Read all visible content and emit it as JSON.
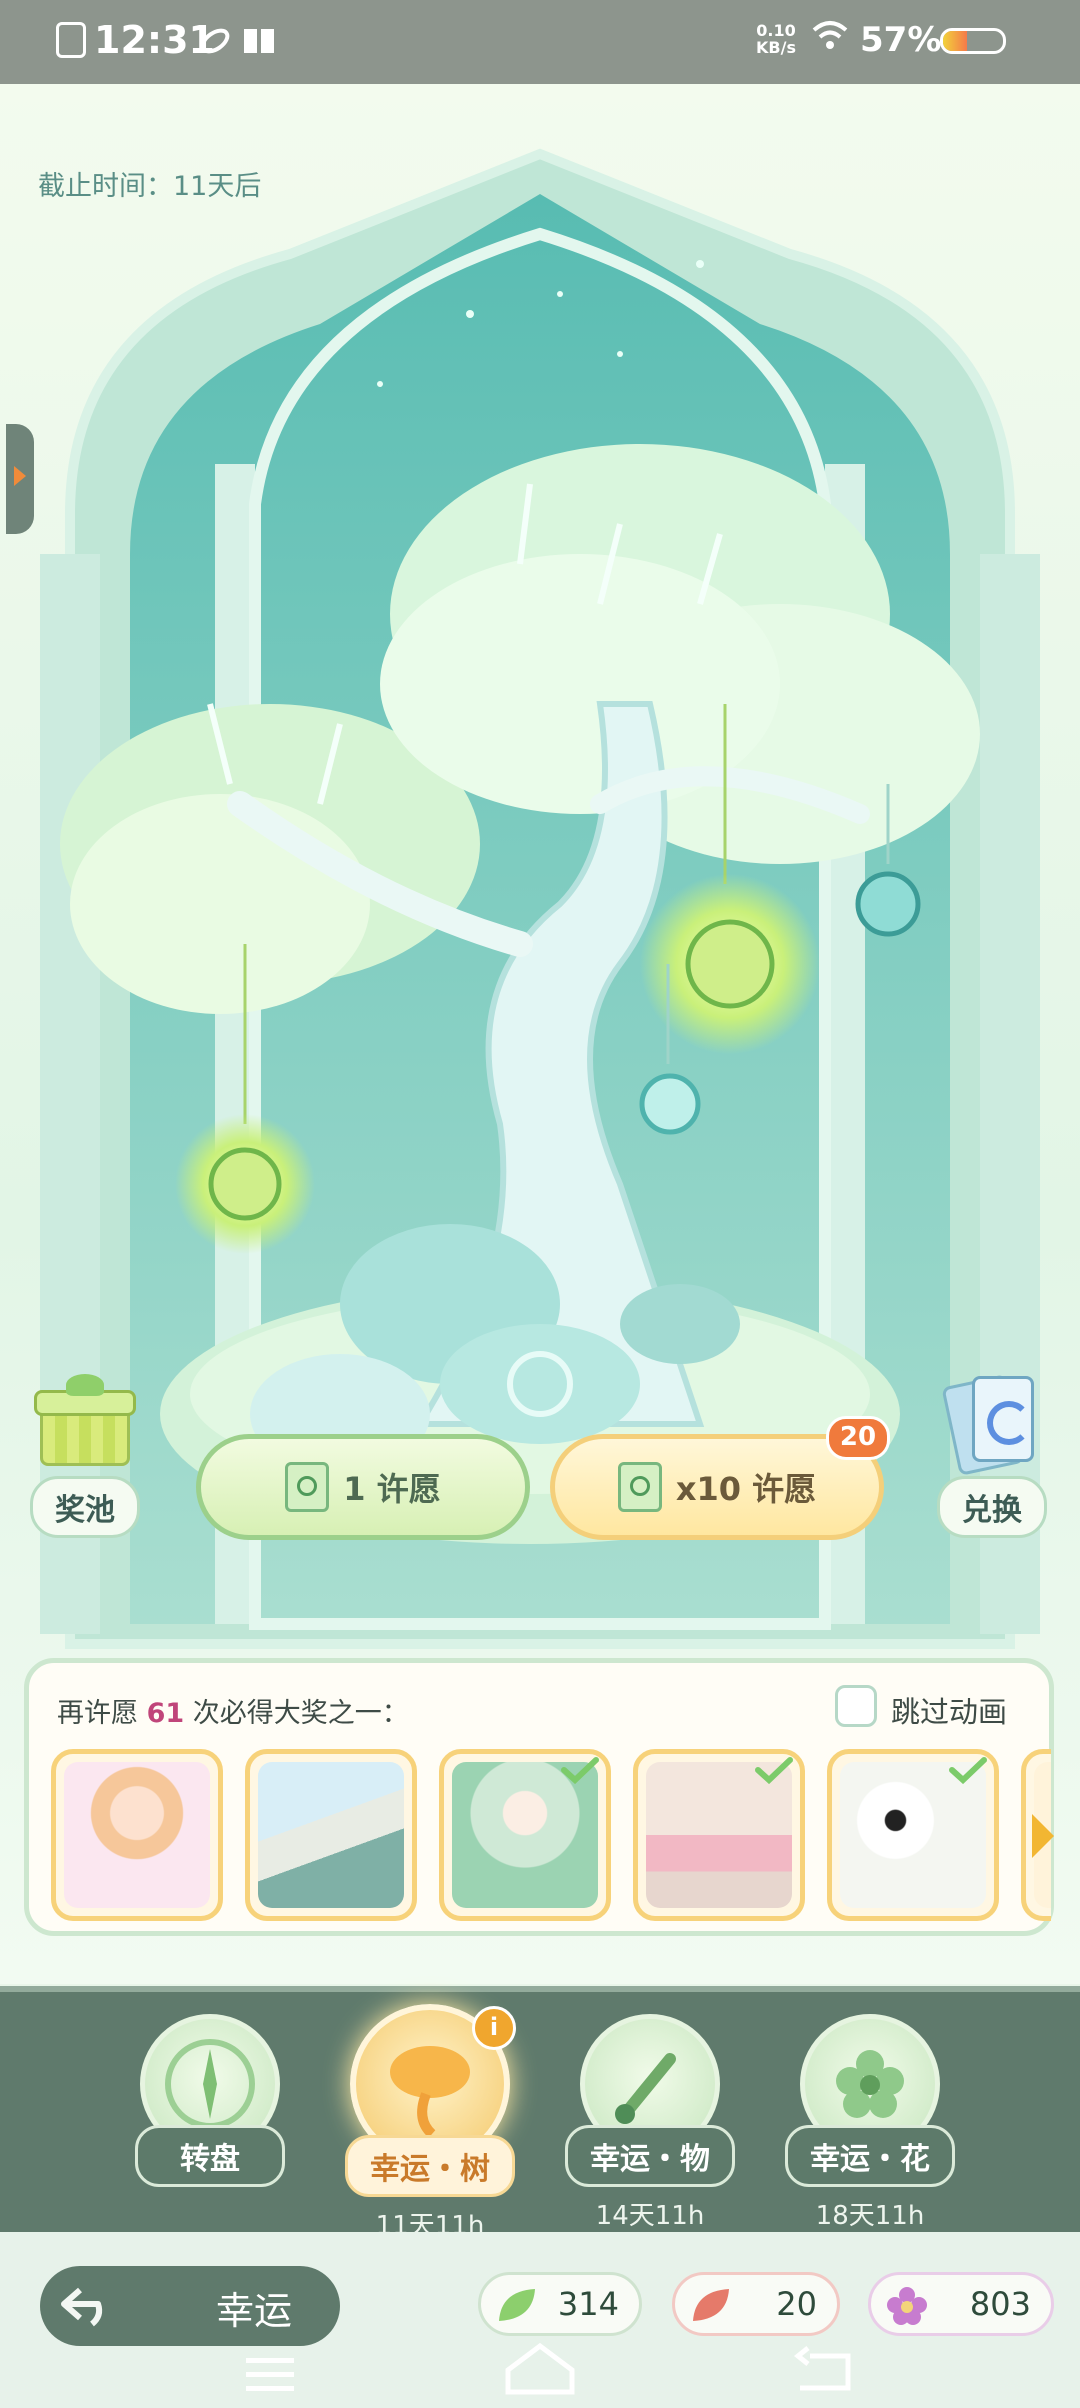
{
  "status_bar": {
    "time": "12:31",
    "net_speed_value": "0.10",
    "net_speed_unit": "KB/s",
    "battery": "57%"
  },
  "event": {
    "deadline": "截止时间：11天后"
  },
  "side_buttons": {
    "pool_label": "奖池",
    "exchange_label": "兑换"
  },
  "wish_buttons": {
    "single_label": "1 许愿",
    "ten_label": "x10 许愿",
    "ten_badge": "20"
  },
  "reward_panel": {
    "title_prefix": "再许愿",
    "title_count": "61",
    "title_suffix": "次必得大奖之一：",
    "skip_animation_label": "跳过动画",
    "prizes": [
      {
        "name": "prize-outfit-girl",
        "owned": false
      },
      {
        "name": "prize-furniture-platform",
        "owned": false
      },
      {
        "name": "prize-fairy-outfit",
        "owned": true
      },
      {
        "name": "prize-room-scene",
        "owned": true
      },
      {
        "name": "prize-panda-cushion",
        "owned": true
      }
    ]
  },
  "bottom_nav": {
    "items": [
      {
        "label": "转盘",
        "sub": ""
      },
      {
        "label": "幸运・树",
        "sub": "11天11h"
      },
      {
        "label": "幸运・物",
        "sub": "14天11h"
      },
      {
        "label": "幸运・花",
        "sub": "18天11h"
      }
    ],
    "info_badge": "i"
  },
  "footer": {
    "back_label": "幸运",
    "resources": [
      {
        "icon": "green-leaf-icon",
        "value": "314"
      },
      {
        "icon": "red-leaf-icon",
        "value": "20"
      },
      {
        "icon": "purple-flower-icon",
        "value": "803"
      }
    ]
  },
  "colors": {
    "accent_green": "#5f7a6c",
    "highlight_pink": "#c0457a",
    "badge_orange": "#f07a3c"
  }
}
